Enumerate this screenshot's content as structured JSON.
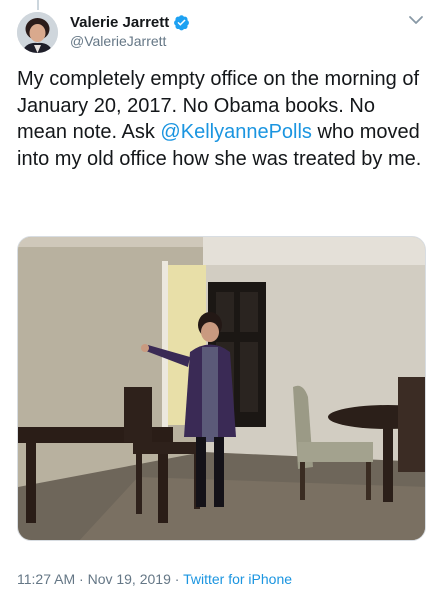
{
  "tweet": {
    "display_name": "Valerie Jarrett",
    "handle": "@ValerieJarrett",
    "text_before": "My completely empty office on the morning of January 20, 2017.  No Obama books.  No mean note.  Ask ",
    "mention": "@KellyannePolls",
    "text_after": " who moved into my old office how she was treated by me.",
    "time": "11:27 AM",
    "separator": " · ",
    "date": "Nov 19, 2019",
    "source": "Twitter for iPhone"
  },
  "colors": {
    "link": "#1b95e0",
    "secondary_text": "#657786",
    "primary_text": "#14171a",
    "verified_badge": "#1da1f2"
  },
  "icons": {
    "verified": "verified-badge-icon",
    "menu": "chevron-down-icon"
  }
}
